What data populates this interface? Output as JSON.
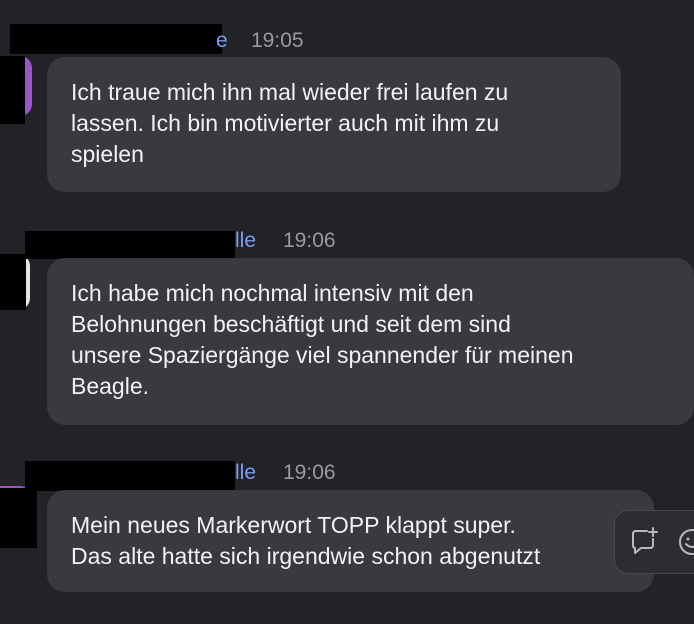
{
  "messages": [
    {
      "author_visible": "e",
      "time": "19:05",
      "text": "Ich traue mich ihn mal wieder frei laufen zu\nlassen. Ich bin motivierter auch mit ihm zu\nspielen",
      "avatar_color": "#9a56c9"
    },
    {
      "author_visible": "lle",
      "time": "19:06",
      "text": "Ich habe mich nochmal intensiv mit den\nBelohnungen beschäftigt und seit dem sind\nunsere Spaziergänge viel spannender für meinen\nBeagle.",
      "avatar_color": "#e6e6e6"
    },
    {
      "author_visible": "lle",
      "time": "19:06",
      "text": "Mein neues Markerwort TOPP klappt super.\nDas alte hatte sich irgendwie schon abgenutzt",
      "avatar_color": "#9a56c9"
    }
  ],
  "hover_actions": [
    {
      "icon": "add-reaction-comment-icon"
    },
    {
      "icon": "emoji-icon"
    }
  ],
  "colors": {
    "background": "#232226",
    "bubble": "#3a393d",
    "name_link": "#7b9cf0",
    "timestamp": "#9a9a9e",
    "text": "#f2f2f4"
  }
}
